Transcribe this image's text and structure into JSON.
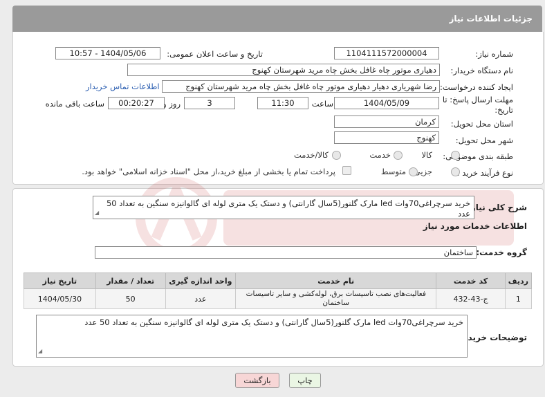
{
  "header": {
    "title": "جزئیات اطلاعات نیاز"
  },
  "fields": {
    "need_number_label": "شماره نیاز:",
    "need_number": "1104111572000004",
    "announce_label": "تاریخ و ساعت اعلان عمومی:",
    "announce_value": "1404/05/06 - 10:57",
    "buyer_org_label": "نام دستگاه خریدار:",
    "buyer_org": "دهیاری موتور چاه غافل بخش چاه مرید شهرستان کهنوج",
    "creator_label": "ایجاد کننده درخواست:",
    "creator": "رضا شهریاری دهیار دهیاری موتور چاه غافل بخش چاه مرید شهرستان کهنوج",
    "contact_link": "اطلاعات تماس خریدار",
    "deadline_label_1": "مهلت ارسال پاسخ: تا",
    "deadline_label_2": "تاریخ:",
    "deadline_date": "1404/05/09",
    "time_label": "ساعت",
    "deadline_time": "11:30",
    "days_value": "3",
    "days_label": "روز و",
    "remaining_time": "00:20:27",
    "remaining_label": "ساعت باقی مانده",
    "province_label": "استان محل تحویل:",
    "province": "کرمان",
    "city_label": "شهر محل تحویل:",
    "city": "کهنوج",
    "category_label": "طبقه بندی موضوعی:",
    "category_options": [
      "کالا",
      "خدمت",
      "کالا/خدمت"
    ],
    "process_label": "نوع فرآیند خرید :",
    "process_options": [
      "جزیی",
      "متوسط"
    ],
    "payment_note": "پرداخت تمام یا بخشی از مبلغ خرید،از محل \"اسناد خزانه اسلامی\" خواهد بود."
  },
  "description": {
    "label": "شرح کلی نیاز:",
    "text": "خرید سرچراغی70وات led مارک گلنور(5سال گارانتی) و دستک یک متری لوله ای گالوانیزه سنگین به تعداد 50 عدد"
  },
  "services": {
    "section_title": "اطلاعات خدمات مورد نیاز",
    "group_label": "گروه خدمت:",
    "group_value": "ساختمان",
    "columns": [
      "ردیف",
      "کد خدمت",
      "نام خدمت",
      "واحد اندازه گیری",
      "تعداد / مقدار",
      "تاریخ نیاز"
    ],
    "rows": [
      [
        "1",
        "ج-43-432",
        "فعالیت‌های نصب تاسیسات برق، لوله‌کشی و سایر تاسیسات ساختمان",
        "عدد",
        "50",
        "1404/05/30"
      ]
    ]
  },
  "buyer_notes": {
    "label": "توضیحات خریدار:",
    "text": "خرید سرچراغی70وات led مارک گلنور(5سال گارانتی) و دستک یک متری لوله ای گالوانیزه سنگین به تعداد 50 عدد"
  },
  "buttons": {
    "print": "چاپ",
    "back": "بازگشت"
  },
  "colors": {
    "header_bg": "#9a9a9a",
    "link": "#2a5db0",
    "back_button_bg": "#f7d6d6",
    "print_button_bg": "#eaf6e4"
  }
}
